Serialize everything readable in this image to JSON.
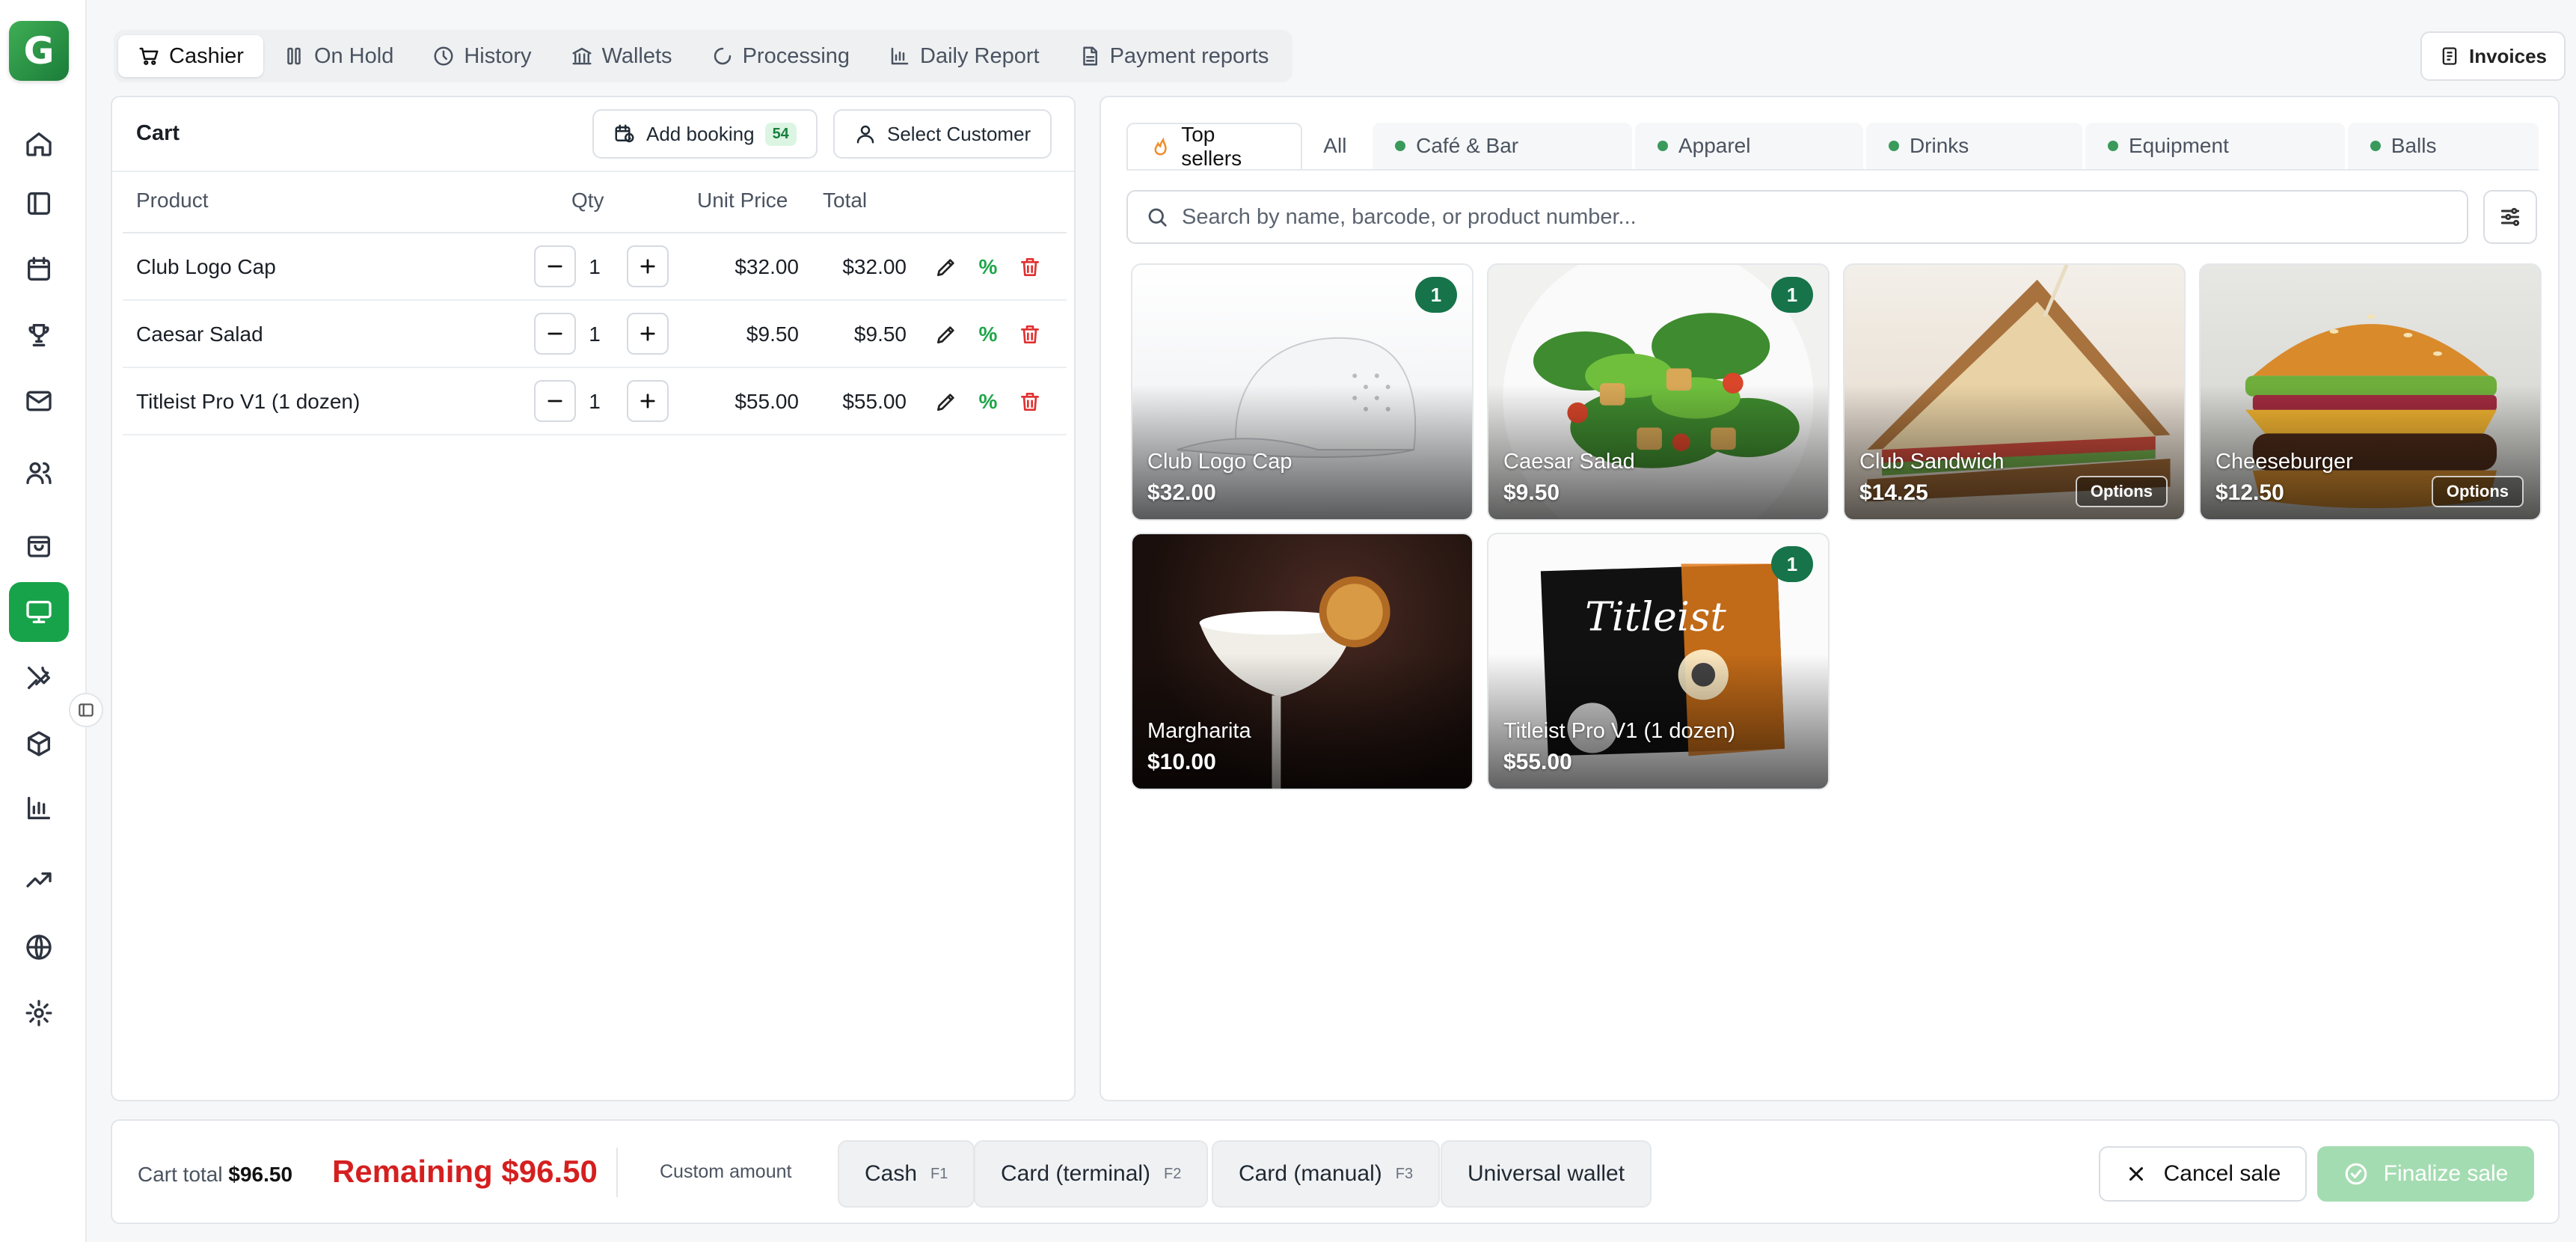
{
  "nav_tabs": [
    {
      "label": "Cashier",
      "icon": "cart-icon"
    },
    {
      "label": "On Hold",
      "icon": "pause-icon"
    },
    {
      "label": "History",
      "icon": "clock-icon"
    },
    {
      "label": "Wallets",
      "icon": "bank-icon"
    },
    {
      "label": "Processing",
      "icon": "spinner-icon"
    },
    {
      "label": "Daily Report",
      "icon": "bar-chart-icon"
    },
    {
      "label": "Payment reports",
      "icon": "document-icon"
    }
  ],
  "invoices_label": "Invoices",
  "sidebar": {
    "logo": "G",
    "icons": [
      "home-icon",
      "panel-icon",
      "calendar-icon",
      "trophy-icon",
      "mail-icon",
      "users-icon",
      "shopping-bag-icon",
      "monitor-icon",
      "tools-icon",
      "package-icon",
      "bar-chart-icon",
      "trending-up-icon",
      "globe-icon",
      "settings-icon"
    ],
    "active": "monitor-icon"
  },
  "cart": {
    "title": "Cart",
    "add_booking_label": "Add booking",
    "booking_count": "54",
    "select_customer_label": "Select Customer",
    "headers": {
      "product": "Product",
      "qty": "Qty",
      "unit_price": "Unit Price",
      "total": "Total"
    },
    "discount_symbol": "%",
    "items": [
      {
        "product": "Club Logo Cap",
        "qty": "1",
        "unit_price": "$32.00",
        "total": "$32.00"
      },
      {
        "product": "Caesar Salad",
        "qty": "1",
        "unit_price": "$9.50",
        "total": "$9.50"
      },
      {
        "product": "Titleist Pro V1 (1 dozen)",
        "qty": "1",
        "unit_price": "$55.00",
        "total": "$55.00"
      }
    ]
  },
  "categories": [
    {
      "label": "Top sellers",
      "active": true
    },
    {
      "label": "All"
    },
    {
      "label": "Café & Bar"
    },
    {
      "label": "Apparel"
    },
    {
      "label": "Drinks"
    },
    {
      "label": "Equipment"
    },
    {
      "label": "Balls"
    }
  ],
  "search": {
    "placeholder": "Search by name, barcode, or product number..."
  },
  "products": [
    {
      "name": "Club Logo Cap",
      "price": "$32.00",
      "qty_badge": "1",
      "options": null
    },
    {
      "name": "Caesar Salad",
      "price": "$9.50",
      "qty_badge": "1",
      "options": null
    },
    {
      "name": "Club Sandwich",
      "price": "$14.25",
      "qty_badge": null,
      "options": "Options"
    },
    {
      "name": "Cheeseburger",
      "price": "$12.50",
      "qty_badge": null,
      "options": "Options"
    },
    {
      "name": "Margharita",
      "price": "$10.00",
      "qty_badge": null,
      "options": null
    },
    {
      "name": "Titleist Pro V1 (1 dozen)",
      "price": "$55.00",
      "qty_badge": "1",
      "options": null
    }
  ],
  "footer": {
    "cart_total_label": "Cart total",
    "cart_total_value": "$96.50",
    "remaining_label": "Remaining $96.50",
    "custom_amount_label": "Custom amount",
    "payments": [
      {
        "label": "Cash",
        "key": "F1"
      },
      {
        "label": "Card (terminal)",
        "key": "F2"
      },
      {
        "label": "Card (manual)",
        "key": "F3"
      },
      {
        "label": "Universal wallet",
        "key": ""
      }
    ],
    "cancel_label": "Cancel sale",
    "finalize_label": "Finalize sale"
  },
  "colors": {
    "accent": "#17a34a",
    "remaining": "#d51f1f",
    "badge": "#16734a",
    "finalize_disabled": "#a4dcb1"
  }
}
